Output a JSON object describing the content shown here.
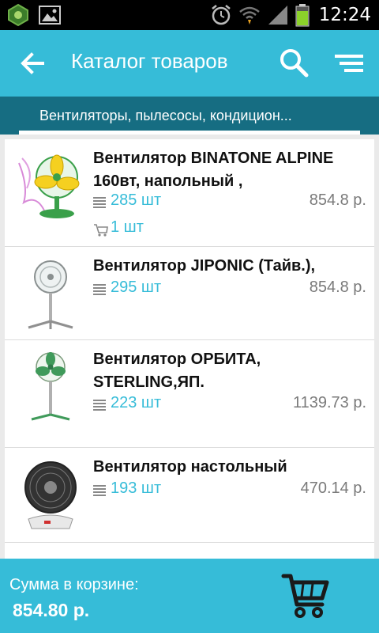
{
  "status_bar": {
    "time": "12:24",
    "icons": [
      "app-icon",
      "image-icon",
      "alarm-icon",
      "wifi-icon",
      "signal-icon",
      "battery-icon"
    ]
  },
  "action_bar": {
    "title": "Каталог товаров",
    "icons": [
      "back-arrow-icon",
      "search-icon",
      "menu-icon"
    ],
    "color": "#36bcd8"
  },
  "tab": {
    "label": "Вентиляторы, пылесосы, кондицион...",
    "color": "#166d82"
  },
  "products": [
    {
      "name": "Вентилятор BINATONE ALPINE 160вт, напольный ,",
      "stock": "285 шт",
      "price": "854.8 р.",
      "cart_qty": "1 шт",
      "image": "yellow-floor-fan"
    },
    {
      "name": "Вентилятор JIPONIC (Тайв.),",
      "stock": "295 шт",
      "price": "854.8 р.",
      "image": "white-stand-fan"
    },
    {
      "name": "Вентилятор ОРБИТА, STERLING,ЯП.",
      "stock": "223 шт",
      "price": "1139.73 р.",
      "image": "green-stand-fan"
    },
    {
      "name": "Вентилятор настольный",
      "stock": "193 шт",
      "price": "470.14 р.",
      "image": "black-table-fan"
    }
  ],
  "bottom_bar": {
    "label": "Сумма в корзине:",
    "sum": "854.80 р.",
    "icon": "cart-icon"
  },
  "colors": {
    "accent": "#36bcd8",
    "tab_bg": "#166d82",
    "price": "#7a7a7a"
  }
}
